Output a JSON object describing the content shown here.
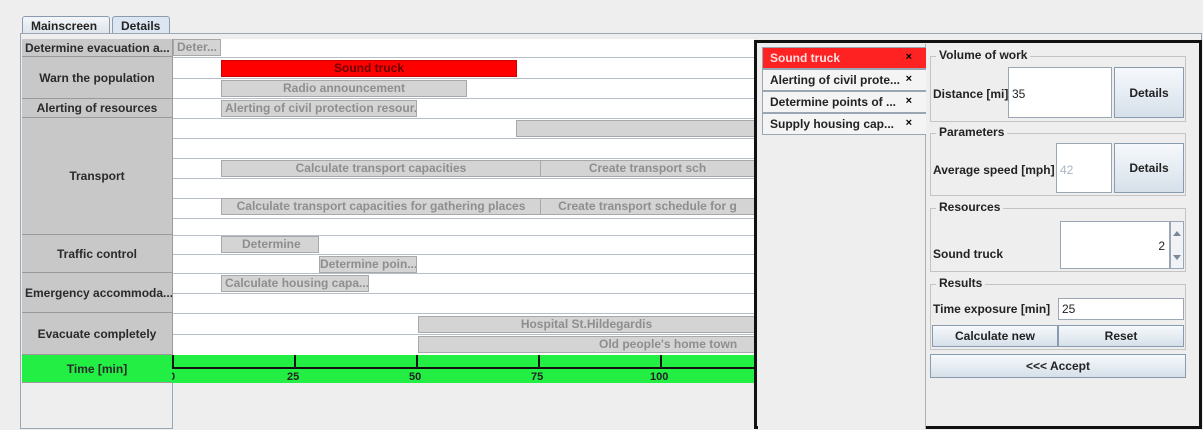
{
  "tabs": [
    "Mainscreen",
    "Details"
  ],
  "rows": [
    "Determine evacuation a...",
    "Warn the population",
    "Alerting of resources",
    "Transport",
    "Traffic control",
    "Emergency accommoda...",
    "Evacuate completely",
    "Time [min]"
  ],
  "tasks": {
    "determine_short": "Deter...",
    "sound_truck": "Sound truck",
    "radio": "Radio announcement",
    "alerting_cp": "Alerting of civil protection resour...",
    "calc_transport": "Calculate transport capacities",
    "create_transport": "Create transport sch",
    "calc_gathering": "Calculate transport capacities for gathering places",
    "create_schedule_g": "Create transport schedule for g",
    "determine": "Determine",
    "determine_poin": "Determine poin...",
    "calc_housing": "Calculate housing capa...",
    "hospital": "Hospital St.Hildegardis",
    "old_people": "Old people's home town"
  },
  "timeline": {
    "ticks": [
      "0",
      "25",
      "50",
      "75",
      "100"
    ],
    "values": [
      0,
      25,
      50,
      75,
      100
    ]
  },
  "detail_tabs": [
    "Sound truck",
    "Alerting of civil prote...",
    "Determine points of ...",
    "Supply housing cap..."
  ],
  "close_glyph": "×",
  "volume": {
    "title": "Volume of work",
    "distance_label": "Distance [mi]",
    "distance_value": "35",
    "details_label": "Details"
  },
  "parameters": {
    "title": "Parameters",
    "speed_label": "Average speed [mph]",
    "speed_value": "42",
    "details_label": "Details"
  },
  "resources": {
    "title": "Resources",
    "item_label": "Sound truck",
    "item_value": "2"
  },
  "results": {
    "title": "Results",
    "exposure_label": "Time exposure [min]",
    "exposure_value": "25",
    "calc_label": "Calculate new",
    "reset_label": "Reset"
  },
  "accept_label": "<<< Accept"
}
